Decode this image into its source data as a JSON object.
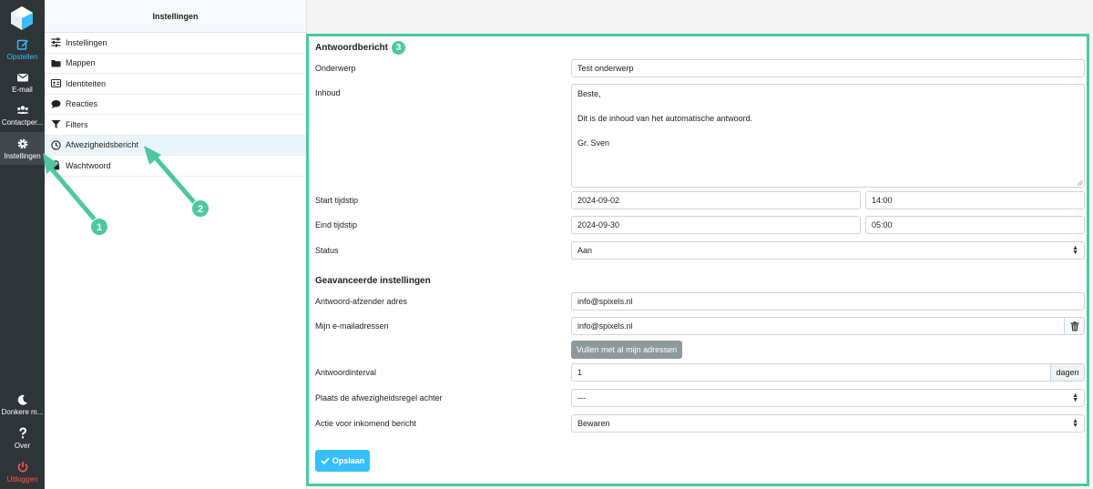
{
  "appbar": {
    "items": [
      {
        "label": "Opstellen",
        "icon": "compose-icon"
      },
      {
        "label": "E-mail",
        "icon": "envelope-icon"
      },
      {
        "label": "Contactper...",
        "icon": "contacts-icon"
      },
      {
        "label": "Instellingen",
        "icon": "gear-icon"
      }
    ],
    "bottom": [
      {
        "label": "Donkere m...",
        "icon": "moon-icon"
      },
      {
        "label": "Over",
        "icon": "question-icon"
      },
      {
        "label": "Uitloggen",
        "icon": "power-icon"
      }
    ]
  },
  "settings": {
    "title": "Instellingen",
    "items": [
      {
        "label": "Instellingen",
        "icon": "sliders-icon"
      },
      {
        "label": "Mappen",
        "icon": "folder-icon"
      },
      {
        "label": "Identiteiten",
        "icon": "id-card-icon"
      },
      {
        "label": "Reacties",
        "icon": "comment-icon"
      },
      {
        "label": "Filters",
        "icon": "filter-icon"
      },
      {
        "label": "Afwezigheidsbericht",
        "icon": "clock-icon"
      },
      {
        "label": "Wachtwoord",
        "icon": "lock-icon"
      }
    ]
  },
  "form": {
    "section1_title": "Antwoordbericht",
    "section1_badge": "3",
    "subject_label": "Onderwerp",
    "subject_value": "Test onderwerp",
    "body_label": "Inhoud",
    "body_lines": [
      "Beste,",
      "",
      "Dit is de inhoud van het automatische antwoord.",
      "",
      "Gr. Sven"
    ],
    "start_label": "Start tijdstip",
    "start_date": "2024-09-02",
    "start_time": "14:00",
    "end_label": "Eind tijdstip",
    "end_date": "2024-09-30",
    "end_time": "05:00",
    "status_label": "Status",
    "status_value": "Aan",
    "section2_title": "Geavanceerde instellingen",
    "sender_label": "Antwoord-afzender adres",
    "sender_value": "info@spixels.nl",
    "my_addresses_label": "Mijn e-mailadressen",
    "my_addresses_value": "info@spixels.nl",
    "fill_button": "Vullen met al mijn adressen",
    "interval_label": "Antwoordinterval",
    "interval_value": "1",
    "interval_unit": "dagen",
    "place_rule_label": "Plaats de afwezigheidsregel achter",
    "place_rule_value": "---",
    "action_label": "Actie voor inkomend bericht",
    "action_value": "Bewaren",
    "save_button": "Opslaan"
  },
  "annotations": {
    "badge1": "1",
    "badge2": "2"
  },
  "colors": {
    "accent": "#37beff",
    "highlight": "#4ec7a0",
    "logout": "#ff5552",
    "appbar": "#2f3437"
  }
}
